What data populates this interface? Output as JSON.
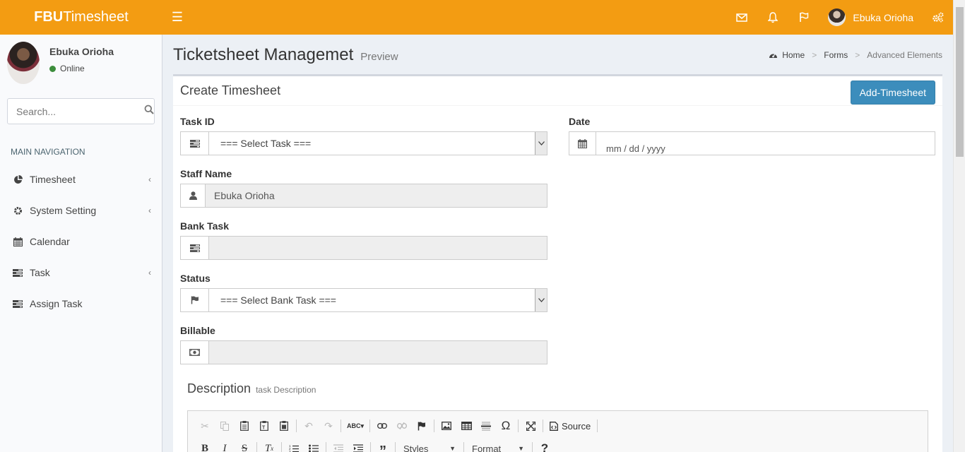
{
  "app": {
    "logo_bold": "FBU",
    "logo_rest": "Timesheet"
  },
  "header": {
    "user_name": "Ebuka Orioha",
    "icons": [
      "envelope-icon",
      "bell-icon",
      "flag-icon",
      "gears-icon"
    ]
  },
  "sidebar": {
    "user": {
      "name": "Ebuka Orioha",
      "status": "Online"
    },
    "search_placeholder": "Search...",
    "nav_header": "MAIN NAVIGATION",
    "items": [
      {
        "label": "Timesheet",
        "icon": "pie-chart-icon",
        "has_children": true
      },
      {
        "label": "System Setting",
        "icon": "gear-icon",
        "has_children": true
      },
      {
        "label": "Calendar",
        "icon": "calendar-icon",
        "has_children": false
      },
      {
        "label": "Task",
        "icon": "tasks-icon",
        "has_children": true
      },
      {
        "label": "Assign Task",
        "icon": "tasks-icon",
        "has_children": false
      }
    ]
  },
  "page": {
    "title": "Ticketsheet Managemet",
    "subtitle": "Preview",
    "breadcrumb": [
      "Home",
      "Forms",
      "Advanced Elements"
    ]
  },
  "form": {
    "title": "Create Timesheet",
    "add_button": "Add-Timesheet",
    "task_id": {
      "label": "Task ID",
      "value": "=== Select Task ==="
    },
    "date": {
      "label": "Date",
      "placeholder": "mm / dd / yyyy"
    },
    "staff_name": {
      "label": "Staff Name",
      "value": "Ebuka Orioha"
    },
    "bank_task": {
      "label": "Bank Task",
      "value": ""
    },
    "status": {
      "label": "Status",
      "value": "=== Select Bank Task ==="
    },
    "billable": {
      "label": "Billable",
      "value": ""
    },
    "description": {
      "title": "Description",
      "hint": "task Description"
    }
  },
  "editor": {
    "source_label": "Source",
    "styles_label": "Styles",
    "format_label": "Format"
  }
}
